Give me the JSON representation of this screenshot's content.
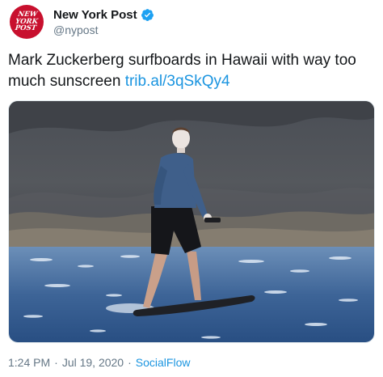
{
  "account": {
    "avatar_lines": [
      "NEW",
      "YORK",
      "POST"
    ],
    "display_name": "New York Post",
    "handle": "@nypost",
    "verified": true,
    "verified_icon": "verified-badge-icon",
    "brand_color": "#c8102e"
  },
  "tweet": {
    "text": "Mark Zuckerberg surfboards in Hawaii with way too much sunscreen ",
    "link_text": "trib.al/3qSkQy4",
    "link_color": "#1b95e0"
  },
  "media": {
    "kind": "photo",
    "subject": "surfer-on-electric-surfboard"
  },
  "meta": {
    "time": "1:24 PM",
    "separator": "·",
    "date": "Jul 19, 2020",
    "source": "SocialFlow"
  }
}
